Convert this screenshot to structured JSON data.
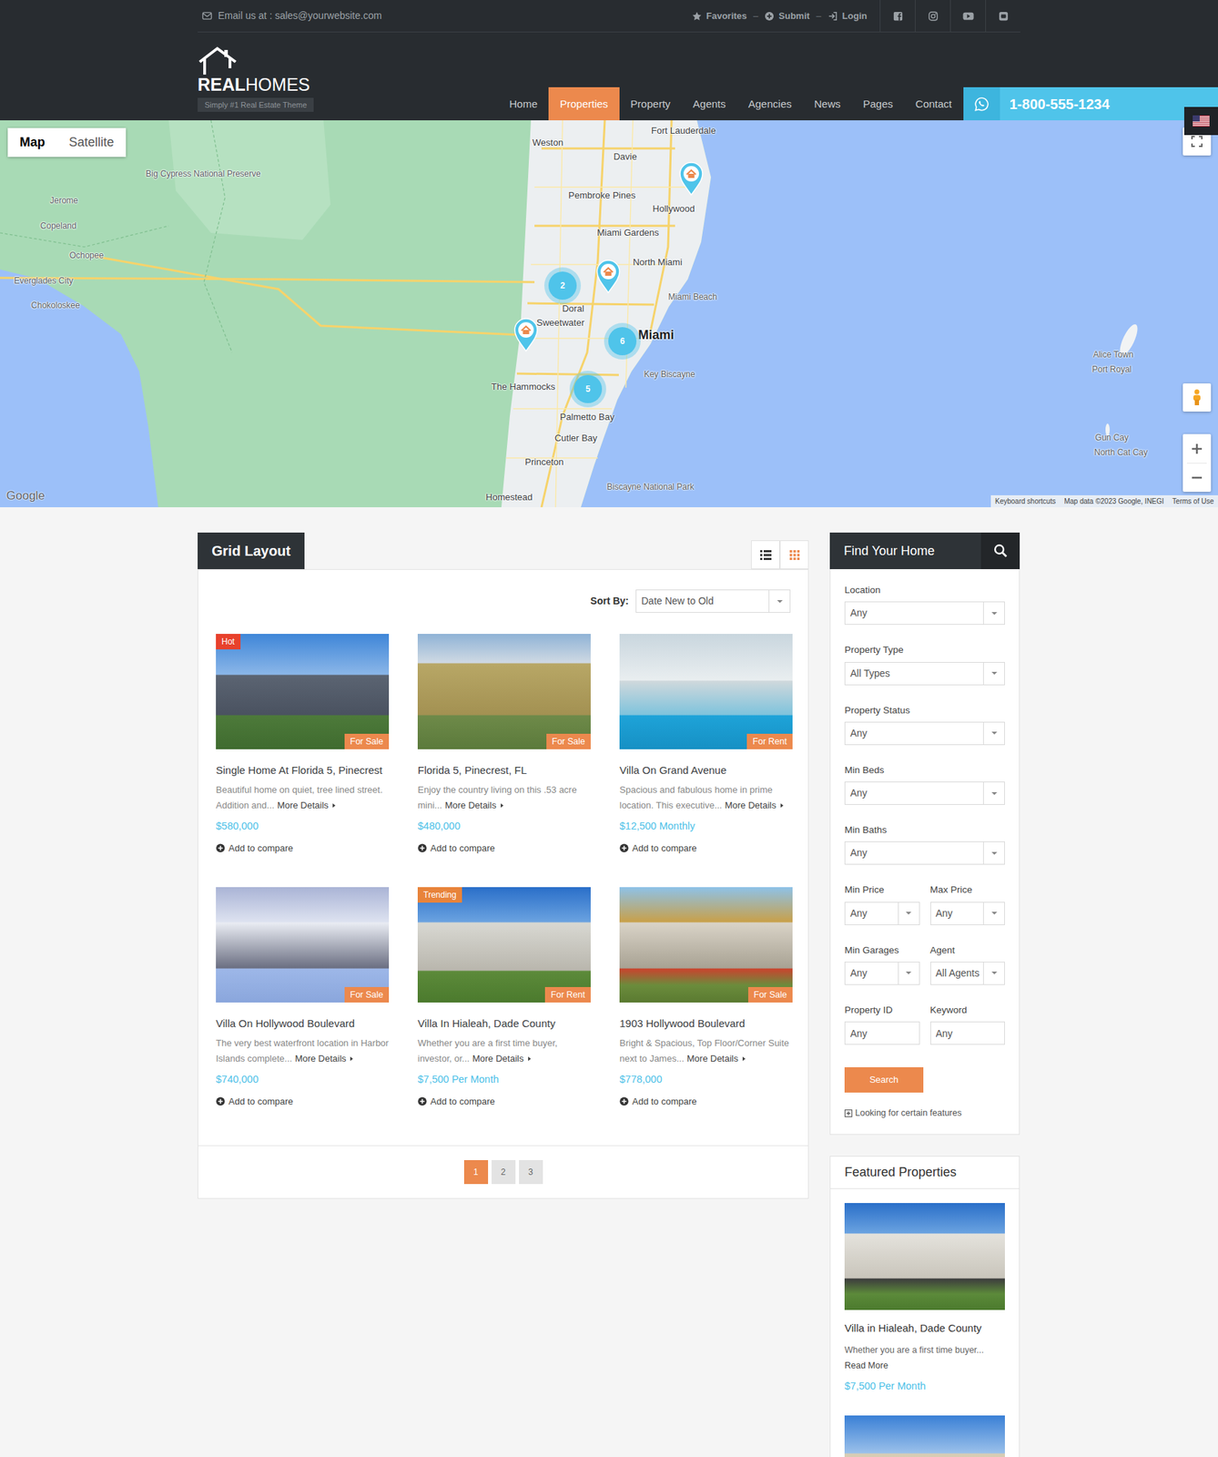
{
  "topbar": {
    "email": "Email us at : sales@yourwebsite.com",
    "links": [
      {
        "label": "Favorites"
      },
      {
        "label": "Submit"
      },
      {
        "label": "Login"
      }
    ],
    "separator": "–"
  },
  "logo": {
    "brand_bold": "REAL",
    "brand_light": "HOMES",
    "tagline": "Simply #1 Real Estate Theme"
  },
  "nav": {
    "items": [
      {
        "label": "Home",
        "selected": false
      },
      {
        "label": "Properties",
        "selected": true
      },
      {
        "label": "Property",
        "selected": false
      },
      {
        "label": "Agents",
        "selected": false
      },
      {
        "label": "Agencies",
        "selected": false
      },
      {
        "label": "News",
        "selected": false
      },
      {
        "label": "Pages",
        "selected": false
      },
      {
        "label": "Contact",
        "selected": false
      }
    ]
  },
  "phone": "1-800-555-1234",
  "map": {
    "types": [
      {
        "label": "Map",
        "selected": true
      },
      {
        "label": "Satellite",
        "selected": false
      }
    ],
    "labels": [
      "Weston",
      "Davie",
      "Fort Lauderdale",
      "Pembroke Pines",
      "Hollywood",
      "Miami Gardens",
      "North Miami",
      "Doral",
      "Sweetwater",
      "Miami",
      "Miami Beach",
      "Key Biscayne",
      "The Hammocks",
      "Palmetto Bay",
      "Cutler Bay",
      "Princeton",
      "Homestead",
      "Biscayne National Park",
      "Big Cypress National Preserve",
      "Jerome",
      "Copeland",
      "Ochopee",
      "Everglades City",
      "Chokoloskee",
      "Alice Town",
      "Port Royal",
      "Gun Cay",
      "North Cat Cay"
    ],
    "clusters": [
      {
        "count": "2"
      },
      {
        "count": "6"
      },
      {
        "count": "5"
      }
    ],
    "pins": [
      {
        "kind": "house"
      },
      {
        "kind": "house"
      },
      {
        "kind": "house"
      }
    ],
    "logo": "Google",
    "attribution": [
      "Keyboard shortcuts",
      "Map data ©2023 Google, INEGI",
      "Terms of Use"
    ]
  },
  "listing": {
    "title": "Grid Layout",
    "views": [
      {
        "kind": "list",
        "selected": false
      },
      {
        "kind": "grid",
        "selected": true
      }
    ],
    "sort_label": "Sort By:",
    "sort_value": "Date New to Old",
    "properties": [
      {
        "tag": "Hot",
        "tag_color": "#e8412c",
        "status": "For Sale",
        "title": "Single Home At Florida 5, Pinecrest",
        "excerpt": "Beautiful home on quiet, tree lined street. Addition and...",
        "more": "More Details",
        "price": "$580,000",
        "compare": "Add to compare"
      },
      {
        "status": "For Sale",
        "title": "Florida 5, Pinecrest, FL",
        "excerpt": "Enjoy the country living on this .53 acre mini...",
        "more": "More Details",
        "price": "$480,000",
        "compare": "Add to compare"
      },
      {
        "status": "For Rent",
        "title": "Villa On Grand Avenue",
        "excerpt": "Spacious and fabulous home in prime location. This executive...",
        "more": "More Details",
        "price": "$12,500 Monthly",
        "compare": "Add to compare"
      },
      {
        "status": "For Sale",
        "title": "Villa On Hollywood Boulevard",
        "excerpt": "The very best waterfront location in Harbor Islands complete...",
        "more": "More Details",
        "price": "$740,000",
        "compare": "Add to compare"
      },
      {
        "tag": "Trending",
        "tag_color": "#e8833a",
        "status": "For Rent",
        "title": "Villa In Hialeah, Dade County",
        "excerpt": "Whether you are a first time buyer, investor, or...",
        "more": "More Details",
        "price": "$7,500 Per Month",
        "compare": "Add to compare"
      },
      {
        "status": "For Sale",
        "title": "1903 Hollywood Boulevard",
        "excerpt": "Bright & Spacious, Top Floor/Corner Suite next to James...",
        "more": "More Details",
        "price": "$778,000",
        "compare": "Add to compare"
      }
    ],
    "pages": [
      {
        "label": "1",
        "selected": true
      },
      {
        "label": "2",
        "selected": false
      },
      {
        "label": "3",
        "selected": false
      }
    ]
  },
  "search": {
    "title": "Find Your Home",
    "rows": [
      [
        {
          "label": "Location",
          "value": "Any",
          "kind": "select"
        }
      ],
      [
        {
          "label": "Property Type",
          "value": "All Types",
          "kind": "select"
        }
      ],
      [
        {
          "label": "Property Status",
          "value": "Any",
          "kind": "select"
        }
      ],
      [
        {
          "label": "Min Beds",
          "value": "Any",
          "kind": "select"
        }
      ],
      [
        {
          "label": "Min Baths",
          "value": "Any",
          "kind": "select"
        }
      ],
      [
        {
          "label": "Min Price",
          "value": "Any",
          "kind": "select"
        },
        {
          "label": "Max Price",
          "value": "Any",
          "kind": "select"
        }
      ],
      [
        {
          "label": "Min Garages",
          "value": "Any",
          "kind": "select"
        },
        {
          "label": "Agent",
          "value": "All Agents",
          "kind": "select"
        }
      ],
      [
        {
          "label": "Property ID",
          "placeholder": "Any",
          "kind": "input"
        },
        {
          "label": "Keyword",
          "placeholder": "Any",
          "kind": "input"
        }
      ]
    ],
    "button": "Search",
    "features": "Looking for certain features"
  },
  "featured": {
    "title": "Featured Properties",
    "items": [
      {
        "title": "Villa in Hialeah, Dade County",
        "excerpt": "Whether you are a first time buyer...",
        "more": "Read More",
        "price": "$7,500 Per Month"
      },
      {}
    ]
  }
}
